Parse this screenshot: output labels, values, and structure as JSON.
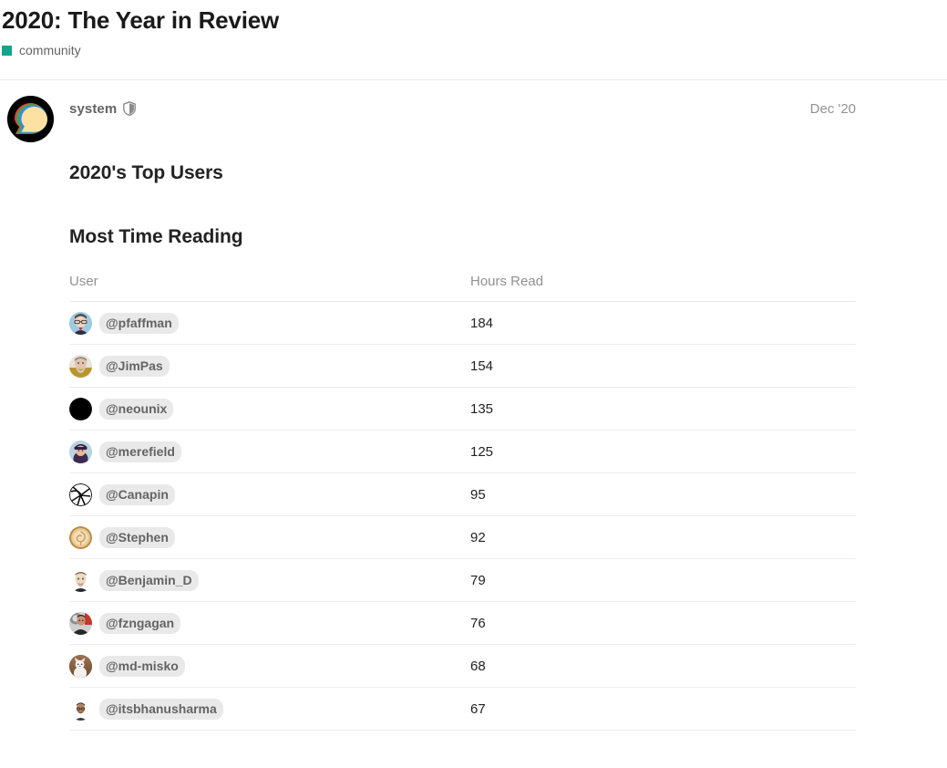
{
  "topic": {
    "title": "2020: The Year in Review",
    "category": {
      "name": "community",
      "color": "#12A589"
    }
  },
  "post": {
    "author": "system",
    "author_badge_icon": "shield-icon",
    "date": "Dec '20",
    "avatar_icon": "discourse-logo-avatar"
  },
  "content": {
    "heading_top_users": "2020's Top Users",
    "heading_section": "Most Time Reading",
    "table": {
      "columns": [
        "User",
        "Hours Read"
      ],
      "rows": [
        {
          "user": "@pfaffman",
          "hours": "184"
        },
        {
          "user": "@JimPas",
          "hours": "154"
        },
        {
          "user": "@neounix",
          "hours": "135"
        },
        {
          "user": "@merefield",
          "hours": "125"
        },
        {
          "user": "@Canapin",
          "hours": "95"
        },
        {
          "user": "@Stephen",
          "hours": "92"
        },
        {
          "user": "@Benjamin_D",
          "hours": "79"
        },
        {
          "user": "@fzngagan",
          "hours": "76"
        },
        {
          "user": "@md-misko",
          "hours": "68"
        },
        {
          "user": "@itsbhanusharma",
          "hours": "67"
        }
      ]
    }
  },
  "chart_data": {
    "type": "table",
    "title": "Most Time Reading",
    "categories": [
      "@pfaffman",
      "@JimPas",
      "@neounix",
      "@merefield",
      "@Canapin",
      "@Stephen",
      "@Benjamin_D",
      "@fzngagan",
      "@md-misko",
      "@itsbhanusharma"
    ],
    "values": [
      184,
      154,
      135,
      125,
      95,
      92,
      79,
      76,
      68,
      67
    ],
    "xlabel": "User",
    "ylabel": "Hours Read"
  }
}
